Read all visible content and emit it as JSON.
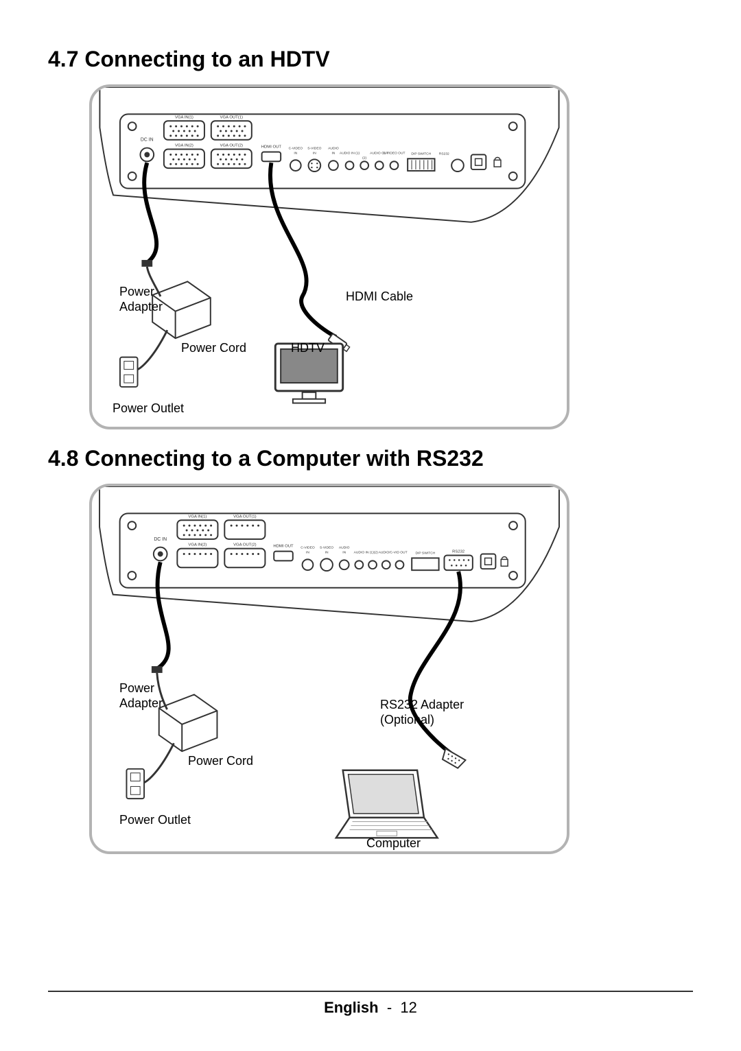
{
  "sections": {
    "s47": {
      "title": "4.7 Connecting to an HDTV",
      "labels": {
        "power_adapter": "Power\nAdapter",
        "power_cord": "Power Cord",
        "power_outlet": "Power Outlet",
        "hdmi_cable": "HDMI Cable",
        "hdtv": "HDTV"
      }
    },
    "s48": {
      "title": "4.8 Connecting to a Computer with RS232",
      "labels": {
        "power_adapter": "Power\nAdapter",
        "power_cord": "Power Cord",
        "power_outlet": "Power Outlet",
        "rs232_adapter": "RS232 Adapter\n(Optional)",
        "computer": "Computer"
      }
    }
  },
  "footer": {
    "language": "English",
    "separator": "-",
    "page_number": "12"
  },
  "port_labels": {
    "dc_in": "DC IN",
    "vga_in1": "VGA IN(1)",
    "vga_in2": "VGA IN(2)",
    "vga_out1": "VGA OUT(1)",
    "vga_out2": "VGA OUT(2)",
    "hdmi_out": "HDMI OUT",
    "c_video_in": "C-VIDEO IN",
    "s_video_in": "S-VIDEO IN",
    "audio_in": "AUDIO IN",
    "audio_in1": "AUDIO IN (1)",
    "audio_in2": "AUDIO IN (2)",
    "audio_out": "AUDIO OUT",
    "c_video_out": "C-VIDEO OUT",
    "dip_switch": "DIP SWITCH",
    "rs232": "RS232"
  }
}
